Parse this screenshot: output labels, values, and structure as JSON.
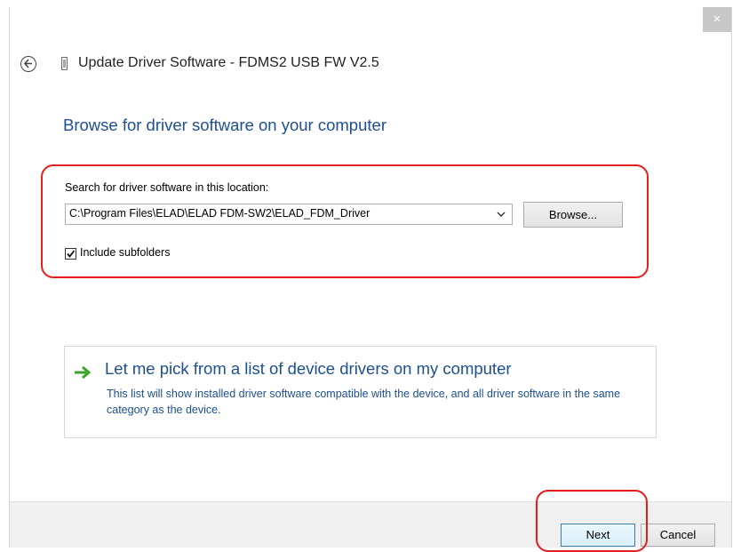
{
  "window": {
    "close_glyph": "×",
    "title": "Update Driver Software - FDMS2 USB FW V2.5"
  },
  "page": {
    "heading": "Browse for driver software on your computer"
  },
  "search": {
    "label": "Search for driver software in this location:",
    "path_value": "C:\\Program Files\\ELAD\\ELAD FDM-SW2\\ELAD_FDM_Driver",
    "browse_label": "Browse...",
    "include_subfolders_label": "Include subfolders",
    "include_subfolders_checked": true
  },
  "pick": {
    "title": "Let me pick from a list of device drivers on my computer",
    "description": "This list will show installed driver software compatible with the device, and all driver software in the same category as the device."
  },
  "footer": {
    "next_label": "Next",
    "cancel_label": "Cancel"
  },
  "colors": {
    "accent_blue": "#1d4f91",
    "highlight_red": "#e3201b",
    "arrow_green": "#3aa32a"
  },
  "icons": {
    "back": "back-arrow-icon",
    "device": "usb-device-icon",
    "dropdown": "chevron-down-icon",
    "pick": "green-arrow-icon",
    "check": "checkmark-icon"
  }
}
